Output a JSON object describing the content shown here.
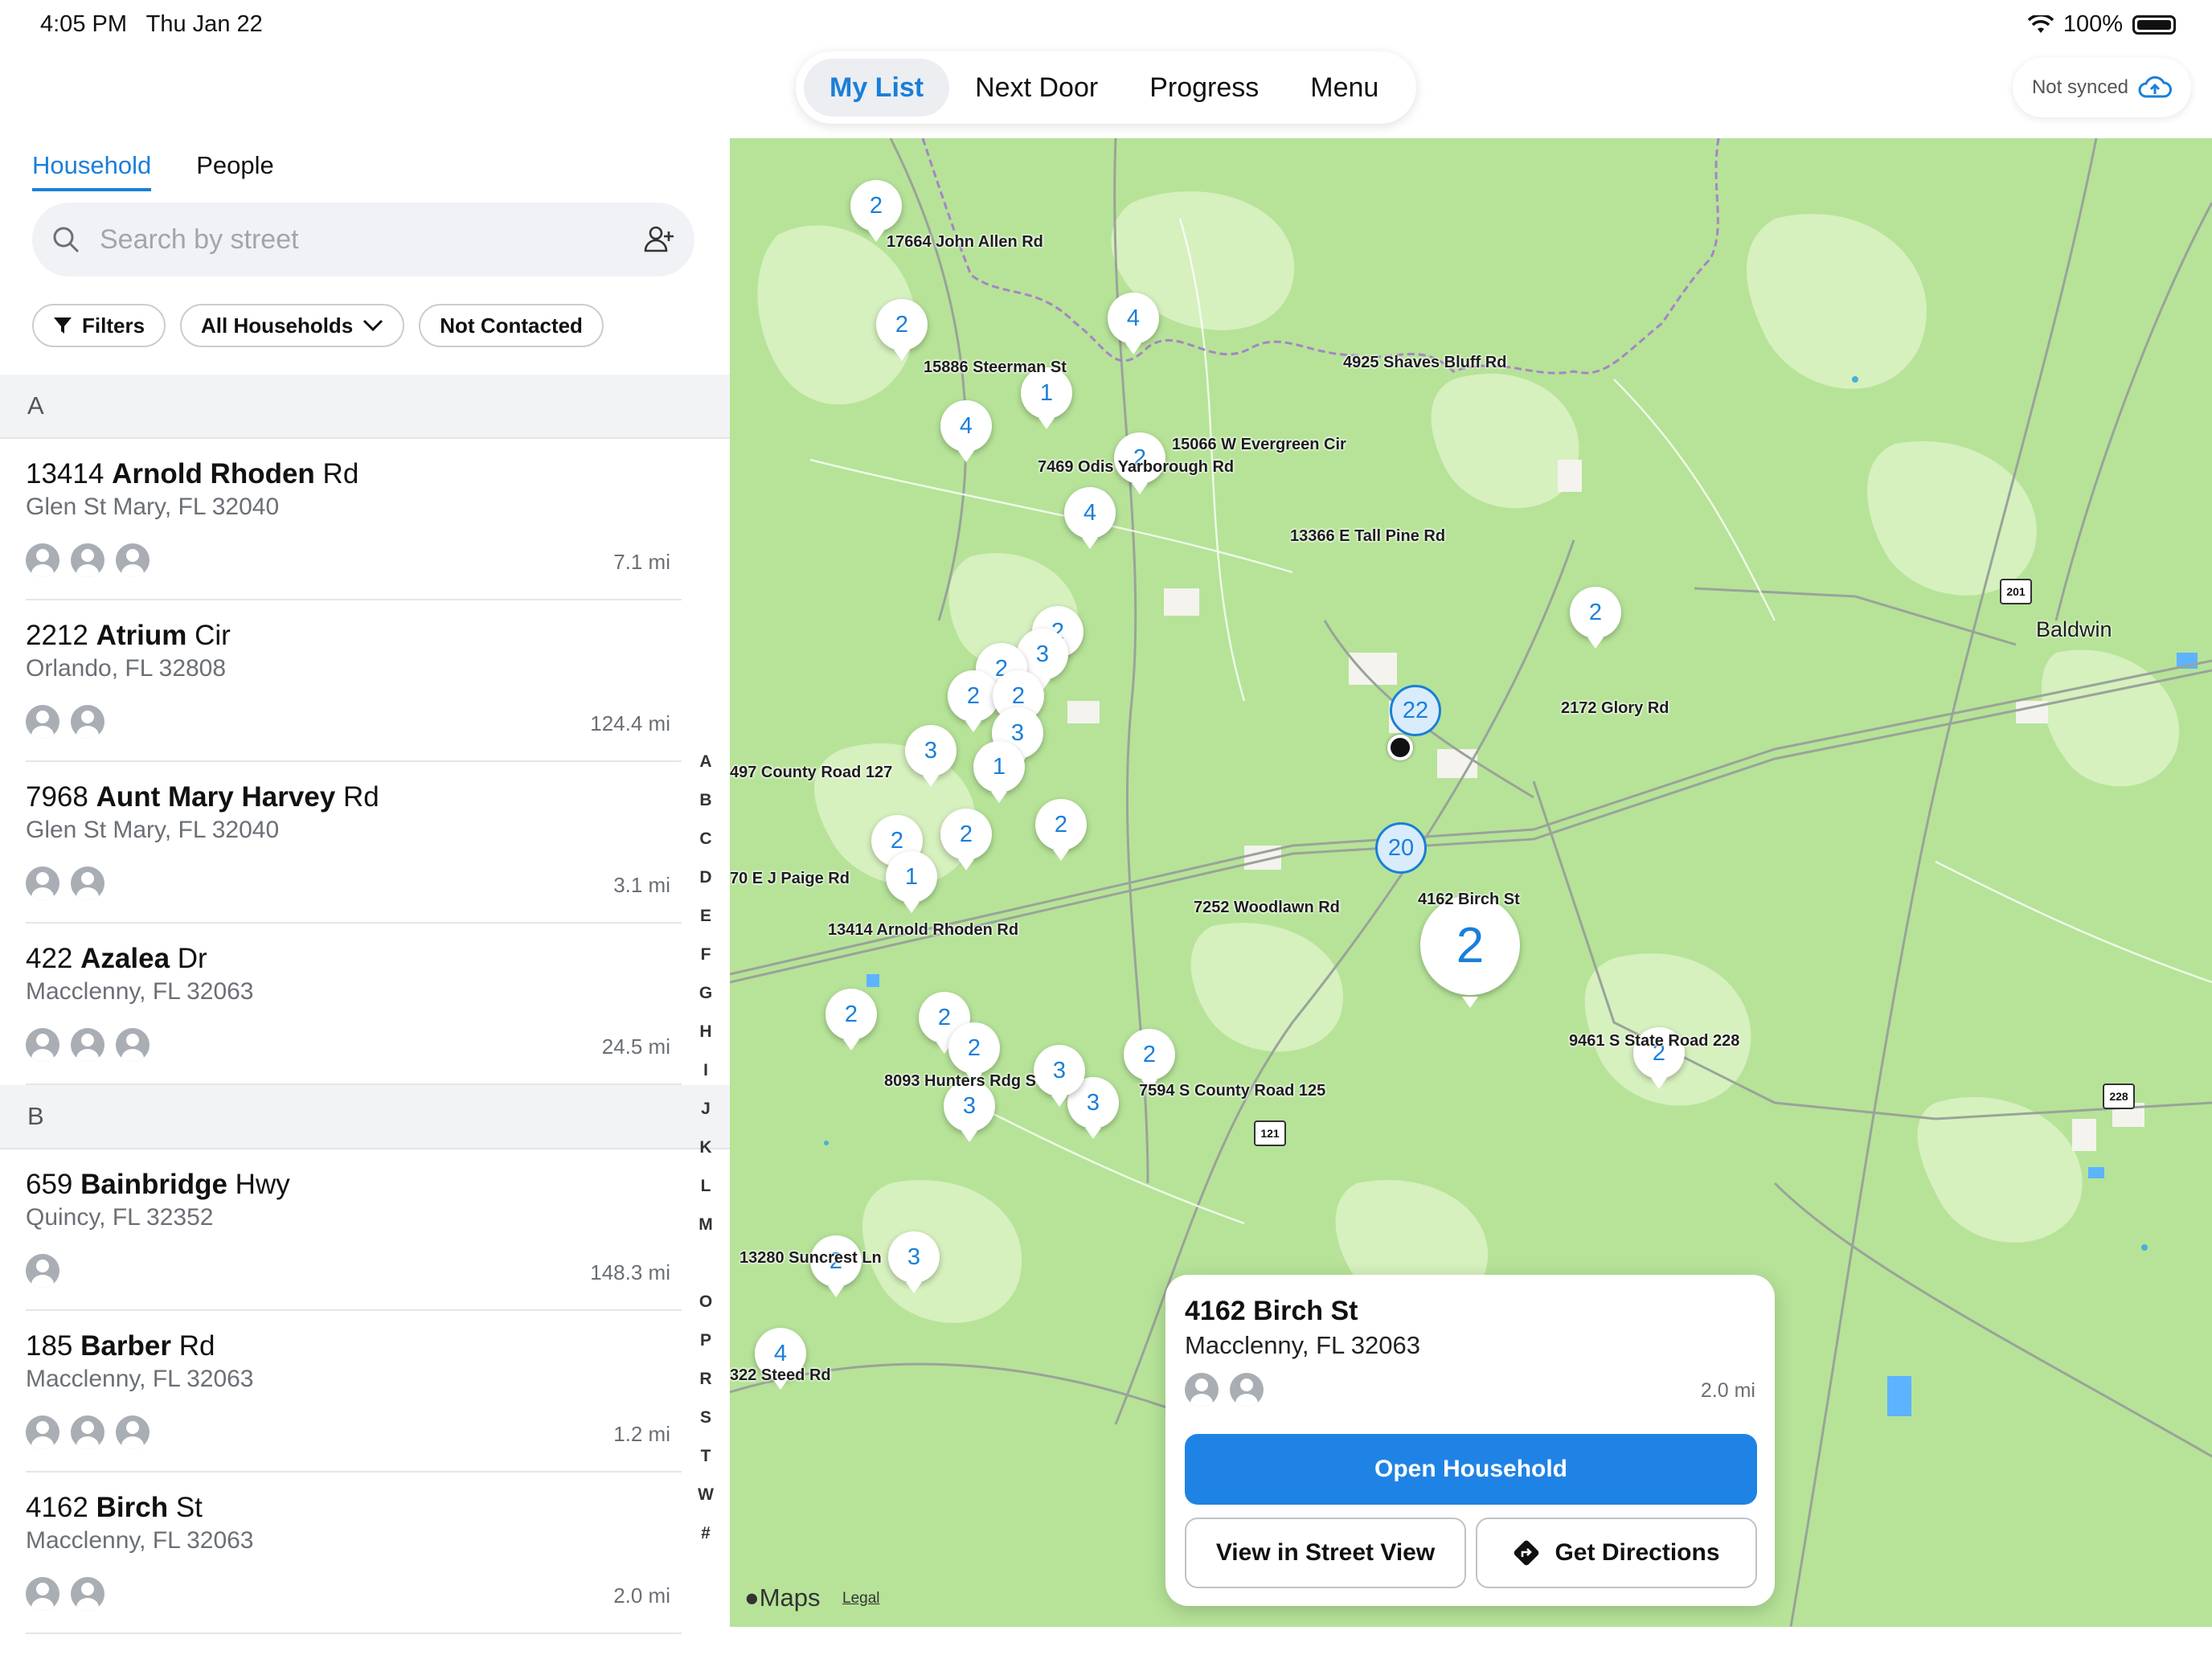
{
  "status": {
    "time": "4:05 PM",
    "date": "Thu Jan 22",
    "battery": "100%"
  },
  "nav": {
    "tabs": [
      "My List",
      "Next Door",
      "Progress",
      "Menu"
    ],
    "active_index": 0
  },
  "sync": {
    "label": "Not synced",
    "icon": "cloud-upload-icon"
  },
  "left": {
    "subtabs": [
      "Household",
      "People"
    ],
    "search_placeholder": "Search by street",
    "filters": {
      "filters_label": "Filters",
      "households_label": "All Households",
      "contacted_label": "Not Contacted"
    },
    "sections": [
      {
        "letter": "A",
        "rows": [
          {
            "num": "13414",
            "street": "Arnold Rhoden",
            "suffix": "Rd",
            "city": "Glen St Mary, FL 32040",
            "people": 3,
            "dist": "7.1 mi"
          },
          {
            "num": "2212",
            "street": "Atrium",
            "suffix": "Cir",
            "city": "Orlando, FL 32808",
            "people": 2,
            "dist": "124.4 mi"
          },
          {
            "num": "7968",
            "street": "Aunt Mary Harvey",
            "suffix": "Rd",
            "city": "Glen St Mary, FL 32040",
            "people": 2,
            "dist": "3.1 mi"
          },
          {
            "num": "422",
            "street": "Azalea",
            "suffix": "Dr",
            "city": "Macclenny, FL 32063",
            "people": 3,
            "dist": "24.5 mi"
          }
        ]
      },
      {
        "letter": "B",
        "rows": [
          {
            "num": "659",
            "street": "Bainbridge",
            "suffix": "Hwy",
            "city": "Quincy, FL 32352",
            "people": 1,
            "dist": "148.3 mi"
          },
          {
            "num": "185",
            "street": "Barber",
            "suffix": "Rd",
            "city": "Macclenny, FL 32063",
            "people": 3,
            "dist": "1.2 mi"
          },
          {
            "num": "4162",
            "street": "Birch",
            "suffix": "St",
            "city": "Macclenny, FL 32063",
            "people": 2,
            "dist": "2.0 mi"
          }
        ]
      }
    ],
    "alpha_index": [
      "A",
      "B",
      "C",
      "D",
      "E",
      "F",
      "G",
      "H",
      "I",
      "J",
      "K",
      "L",
      "M",
      "",
      "O",
      "P",
      "R",
      "S",
      "T",
      "W",
      "#"
    ]
  },
  "map": {
    "town": "Baldwin",
    "brand": "Maps",
    "legal": "Legal",
    "shields": [
      "201",
      "121",
      "228"
    ],
    "pins": [
      "2",
      "2",
      "4",
      "1",
      "4",
      "2",
      "4",
      "2",
      "3",
      "2",
      "2",
      "2",
      "3",
      "1",
      "2",
      "2",
      "3",
      "2",
      "2",
      "1",
      "2",
      "2",
      "2",
      "3",
      "3",
      "2",
      "2",
      "2",
      "3",
      "4",
      "3",
      "22",
      "20",
      "2"
    ],
    "labels": [
      "17664 John Allen Rd",
      "15886 Steerman St",
      "4925 Shaves Bluff Rd",
      "15066 W Evergreen Cir",
      "7469 Odis Yarborough Rd",
      "13366 E Tall Pine Rd",
      "2172 Glory Rd",
      "497 County Road 127",
      "70 E J Paige Rd",
      "13414 Arnold Rhoden Rd",
      "7252 Woodlawn Rd",
      "4162 Birch St",
      "9461 S State Road 228",
      "8093 Hunters Rdg S",
      "7594 S County Road 125",
      "13280 Suncrest Ln",
      "322 Steed Rd"
    ]
  },
  "card": {
    "title": "4162 Birch St",
    "city": "Macclenny, FL 32063",
    "dist": "2.0 mi",
    "primary": "Open Household",
    "street_view": "View in Street View",
    "directions": "Get Directions"
  },
  "colors": {
    "accent": "#1a7fd9",
    "map_green": "#b6e398",
    "button_blue": "#1f83e5"
  }
}
